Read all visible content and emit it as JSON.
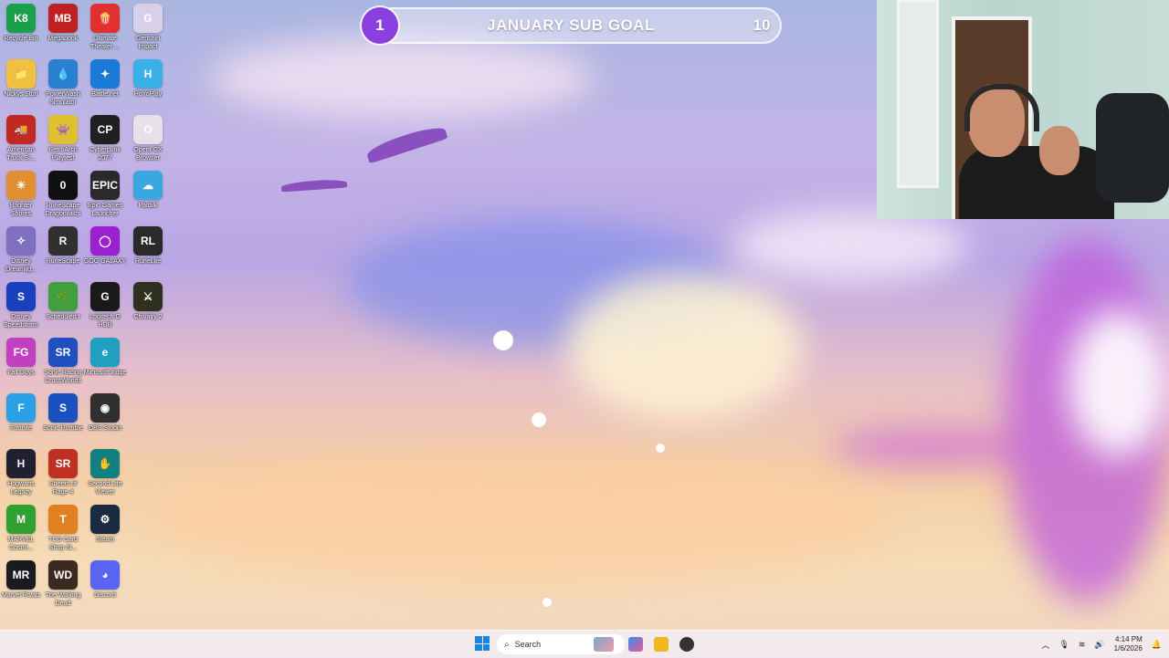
{
  "sub_goal": {
    "current": "1",
    "title": "JANUARY SUB GOAL",
    "target": "10",
    "progress_fraction": 0.1,
    "accent_color": "#8a3fe0"
  },
  "desktop_icons": [
    {
      "label": "Recycle Bin",
      "icon": "recycle-icon",
      "color": "#1aa04a",
      "glyph": "K8"
    },
    {
      "label": "Megabonk",
      "icon": "megabonk-icon",
      "color": "#c02020",
      "glyph": "MB"
    },
    {
      "label": "Ultimate Theater ...",
      "icon": "popcorn-icon",
      "color": "#e03030",
      "glyph": "🍿"
    },
    {
      "label": "Genshin Impact",
      "icon": "genshin-icon",
      "color": "#d8d0e8",
      "glyph": "G"
    },
    {
      "label": "Nickys Stuff",
      "icon": "folder-icon",
      "color": "#f0c040",
      "glyph": "📁"
    },
    {
      "label": "PowerWash Simulator",
      "icon": "powerwash-icon",
      "color": "#2a80d0",
      "glyph": "💧"
    },
    {
      "label": "Battle.net",
      "icon": "battlenet-icon",
      "color": "#1a7ad8",
      "glyph": "✦"
    },
    {
      "label": "HoYoPlay",
      "icon": "hoyoplay-icon",
      "color": "#3ab0e8",
      "glyph": "H"
    },
    {
      "label": "American Truck Si...",
      "icon": "truck-icon",
      "color": "#c02a20",
      "glyph": "🚚"
    },
    {
      "label": "RetroArch Playtest",
      "icon": "retroarch-icon",
      "color": "#e0c030",
      "glyph": "👾"
    },
    {
      "label": "Cyberpunk 2077",
      "icon": "cyberpunk-icon",
      "color": "#202020",
      "glyph": "CP"
    },
    {
      "label": "Opera GX Browser",
      "icon": "opera-icon",
      "color": "#e8e0e8",
      "glyph": "O"
    },
    {
      "label": "Brighter Shores",
      "icon": "brighter-shores-icon",
      "color": "#e09030",
      "glyph": "☀"
    },
    {
      "label": "RuneScape Dragonwilds",
      "icon": "runescape-dragonwilds-icon",
      "color": "#101010",
      "glyph": "0"
    },
    {
      "label": "Epic Games Launcher",
      "icon": "epic-icon",
      "color": "#2a2a2a",
      "glyph": "EPIC"
    },
    {
      "label": "Paltalk",
      "icon": "paltalk-icon",
      "color": "#3aa8e0",
      "glyph": "☁"
    },
    {
      "label": "Disney Dreamlig...",
      "icon": "disney-dreamlight-icon",
      "color": "#8070c0",
      "glyph": "✧"
    },
    {
      "label": "RuneScape",
      "icon": "runescape-icon",
      "color": "#303030",
      "glyph": "R"
    },
    {
      "label": "GOG GALAXY",
      "icon": "gog-icon",
      "color": "#9a20d0",
      "glyph": "◯"
    },
    {
      "label": "RuneLite",
      "icon": "runelite-icon",
      "color": "#2a2a2a",
      "glyph": "RL"
    },
    {
      "label": "Disney Speedstorm",
      "icon": "speedstorm-icon",
      "color": "#1a40c0",
      "glyph": "S"
    },
    {
      "label": "Scheduled I",
      "icon": "schedule-icon",
      "color": "#40a040",
      "glyph": "🌿"
    },
    {
      "label": "Logitech G HUB",
      "icon": "logitech-icon",
      "color": "#1a1a1a",
      "glyph": "G"
    },
    {
      "label": "Chivalry 2",
      "icon": "chivalry-icon",
      "color": "#303020",
      "glyph": "⚔"
    },
    {
      "label": "Fall Guys",
      "icon": "fallguys-icon",
      "color": "#c040c0",
      "glyph": "FG"
    },
    {
      "label": "Sonic Racing CrossWorlds",
      "icon": "sonic-racing-icon",
      "color": "#2050c0",
      "glyph": "SR"
    },
    {
      "label": "Microsoft Edge",
      "icon": "edge-icon",
      "color": "#20a0c0",
      "glyph": "e"
    },
    {
      "label": "",
      "icon": "empty",
      "color": "",
      "glyph": ""
    },
    {
      "label": "Fortnite",
      "icon": "fortnite-icon",
      "color": "#2aa0e8",
      "glyph": "F"
    },
    {
      "label": "Sonic Rumble",
      "icon": "sonic-rumble-icon",
      "color": "#1a50c0",
      "glyph": "S"
    },
    {
      "label": "OBS Studio",
      "icon": "obs-icon",
      "color": "#303030",
      "glyph": "◉"
    },
    {
      "label": "",
      "icon": "empty",
      "color": "",
      "glyph": ""
    },
    {
      "label": "Hogwarts Legacy",
      "icon": "hogwarts-icon",
      "color": "#202030",
      "glyph": "H"
    },
    {
      "label": "Streets of Rage 4",
      "icon": "streets-of-rage-icon",
      "color": "#c03020",
      "glyph": "SR"
    },
    {
      "label": "Second Life Viewer",
      "icon": "second-life-icon",
      "color": "#108080",
      "glyph": "✋"
    },
    {
      "label": "",
      "icon": "empty",
      "color": "",
      "glyph": ""
    },
    {
      "label": "MARVEL Cosmi...",
      "icon": "marvel-cosmic-icon",
      "color": "#30a030",
      "glyph": "M"
    },
    {
      "label": "TCG Card Shop Si...",
      "icon": "tcg-icon",
      "color": "#e08020",
      "glyph": "T"
    },
    {
      "label": "Steam",
      "icon": "steam-icon",
      "color": "#1a2a40",
      "glyph": "⚙"
    },
    {
      "label": "",
      "icon": "empty",
      "color": "",
      "glyph": ""
    },
    {
      "label": "Marvel Rivals",
      "icon": "marvel-rivals-icon",
      "color": "#1a1a20",
      "glyph": "MR"
    },
    {
      "label": "The Walking Dead",
      "icon": "walking-dead-icon",
      "color": "#3a2a20",
      "glyph": "WD"
    },
    {
      "label": "Discord",
      "icon": "discord-icon",
      "color": "#5865f2",
      "glyph": "◕"
    }
  ],
  "taskbar": {
    "search_placeholder": "Search",
    "time": "4:14 PM",
    "date": "1/6/2026"
  }
}
